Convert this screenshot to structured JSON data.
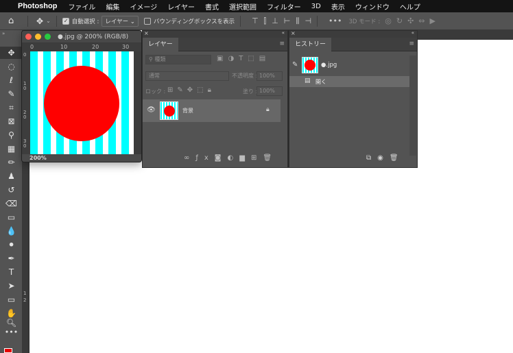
{
  "menubar": {
    "app": "Photoshop",
    "items": [
      "ファイル",
      "編集",
      "イメージ",
      "レイヤー",
      "書式",
      "選択範囲",
      "フィルター",
      "3D",
      "表示",
      "ウィンドウ",
      "ヘルプ"
    ]
  },
  "options": {
    "auto_select_label": "自動選択 :",
    "auto_select_value": "レイヤー",
    "bounding_box_label": "バウンディングボックスを表示",
    "mode_3d": "3D モード :",
    "more": "•••"
  },
  "ruler": {
    "vertical_marks": [
      "1",
      "2"
    ]
  },
  "document": {
    "title": "●.jpg @ 200% (RGB/8)",
    "ruler_h": [
      "0",
      "10",
      "20",
      "30"
    ],
    "ruler_v": [
      "0",
      "1\n0",
      "2\n0",
      "3\n0"
    ],
    "zoom": "200%",
    "colors": {
      "stripe": "#00ffff",
      "circle": "#ff0000"
    }
  },
  "layers_panel": {
    "tab": "レイヤー",
    "search_placeholder": "種類",
    "blend_mode": "通常",
    "opacity_label": "不透明度 :",
    "opacity_value": "100%",
    "lock_label": "ロック :",
    "fill_label": "塗り :",
    "fill_value": "100%",
    "layer_name": "背景"
  },
  "history_panel": {
    "tab": "ヒストリー",
    "snapshot_name": "●.jpg",
    "state_open": "開く"
  }
}
